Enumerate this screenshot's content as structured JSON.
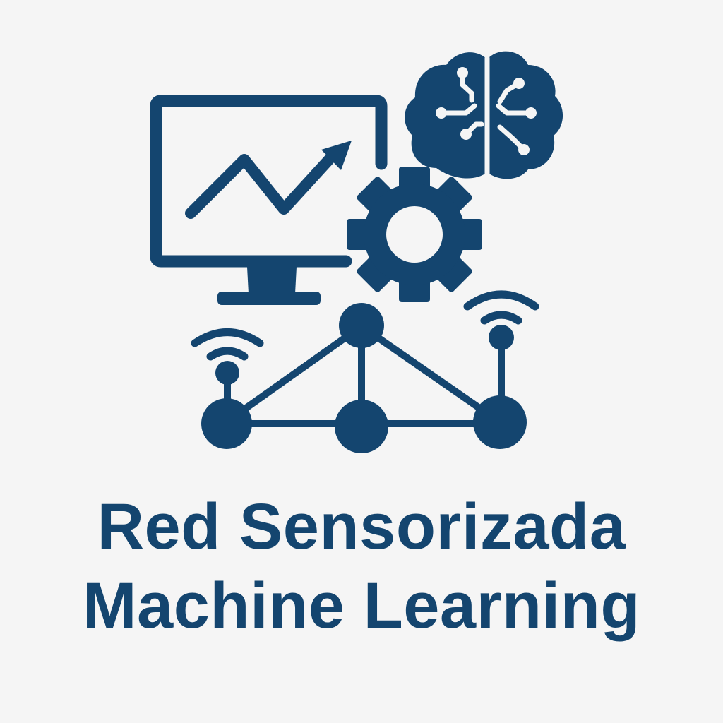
{
  "colors": {
    "primary": "#14456f",
    "background": "#f5f5f5"
  },
  "icons": [
    "monitor-chart-icon",
    "brain-circuit-icon",
    "gear-icon",
    "sensor-network-icon",
    "wireless-signal-icon"
  ],
  "title": {
    "line1": "Red Sensorizada",
    "line2": "Machine Learning"
  }
}
